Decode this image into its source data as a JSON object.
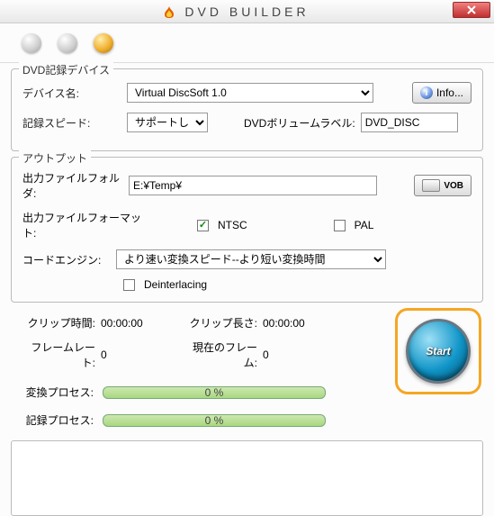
{
  "window": {
    "title": "DVD BUILDER"
  },
  "group1": {
    "legend": "DVD記録デバイス",
    "device_label": "デバイス名:",
    "device_value": "Virtual        DiscSoft 1.0",
    "info_btn": "Info...",
    "speed_label": "記録スピード:",
    "speed_value": "サポートしていませ",
    "volume_label": "DVDボリュームラベル:",
    "volume_value": "DVD_DISC"
  },
  "group2": {
    "legend": "アウトプット",
    "folder_label": "出力ファイルフォルダ:",
    "folder_value": "E:¥Temp¥",
    "vob_btn": "VOB",
    "format_label": "出力ファイルフォーマット:",
    "ntsc_label": "NTSC",
    "pal_label": "PAL",
    "engine_label": "コードエンジン:",
    "engine_value": "より速い変換スピード--より短い変換時間",
    "deint_label": "Deinterlacing"
  },
  "stats": {
    "clip_time_label": "クリップ時間:",
    "clip_time_value": "00:00:00",
    "clip_len_label": "クリップ長さ:",
    "clip_len_value": "00:00:00",
    "framerate_label": "フレームレート:",
    "framerate_value": "0",
    "curframe_label": "現在のフレーム:",
    "curframe_value": "0",
    "conv_label": "変換プロセス:",
    "conv_value": "0 %",
    "rec_label": "記録プロセス:",
    "rec_value": "0 %",
    "start_btn": "Start"
  }
}
